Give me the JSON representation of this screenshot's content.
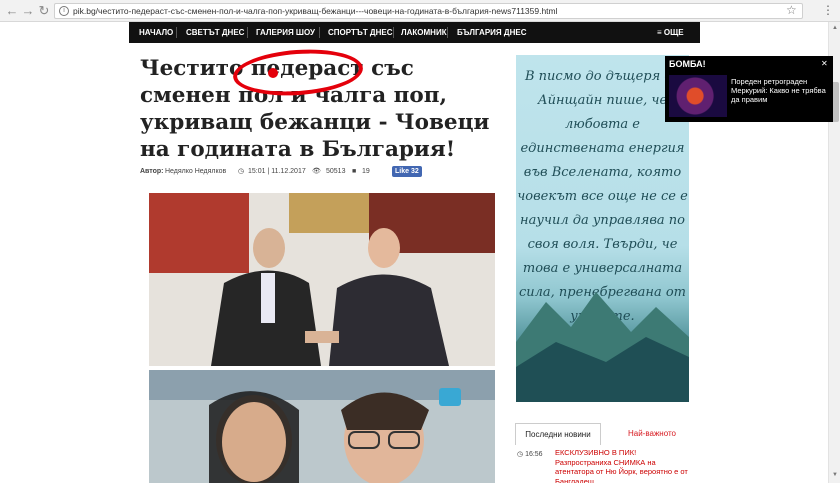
{
  "browser": {
    "url": "pik.bg/честито-педераст-със-сменен-пол-и-чалга-поп-укриващ-бежанци---човеци-на-годината-в-българия-news711359.html"
  },
  "nav": {
    "items": [
      "НАЧАЛО",
      "СВЕТЪТ ДНЕС",
      "ГАЛЕРИЯ ШОУ",
      "СПОРТЪТ ДНЕС",
      "ЛАКОМНИК",
      "БЪЛГАРИЯ ДНЕС"
    ],
    "more": "ОЩЕ"
  },
  "article": {
    "title": "Честито педераст със сменен пол и чалга поп, укриващ бежанци - Човеци на годината в България!",
    "author_label": "Автор:",
    "author": "Недялко Недялков",
    "datetime": "15:01 | 11.12.2017",
    "views": "50513",
    "comments": "19",
    "like_label": "Like 32"
  },
  "ad": {
    "text": "В писмо до дъщеря си Айнщайн пише, че любовта е единствената енергия във Вселената, която човекът все още не се е научил да управлява по своя воля. Твърди, че това е универсалната сила, пренебрегвана от учените."
  },
  "popup": {
    "title": "БОМБА!",
    "news": "Пореден ретрограден Меркурий: Какво не трябва да правим"
  },
  "sidebar": {
    "tab_latest": "Последни новини",
    "tab_important": "Най-важното",
    "news": [
      {
        "time": "16:56",
        "headline": "ЕКСКЛУЗИВНО В ПИК! Разпространиха СНИМКА на атентатора от Ню Йорк, вероятно е от Бангладеш"
      }
    ]
  },
  "colors": {
    "accent": "#e4000b",
    "nav_bg": "#111111",
    "link_red": "#d71920"
  }
}
